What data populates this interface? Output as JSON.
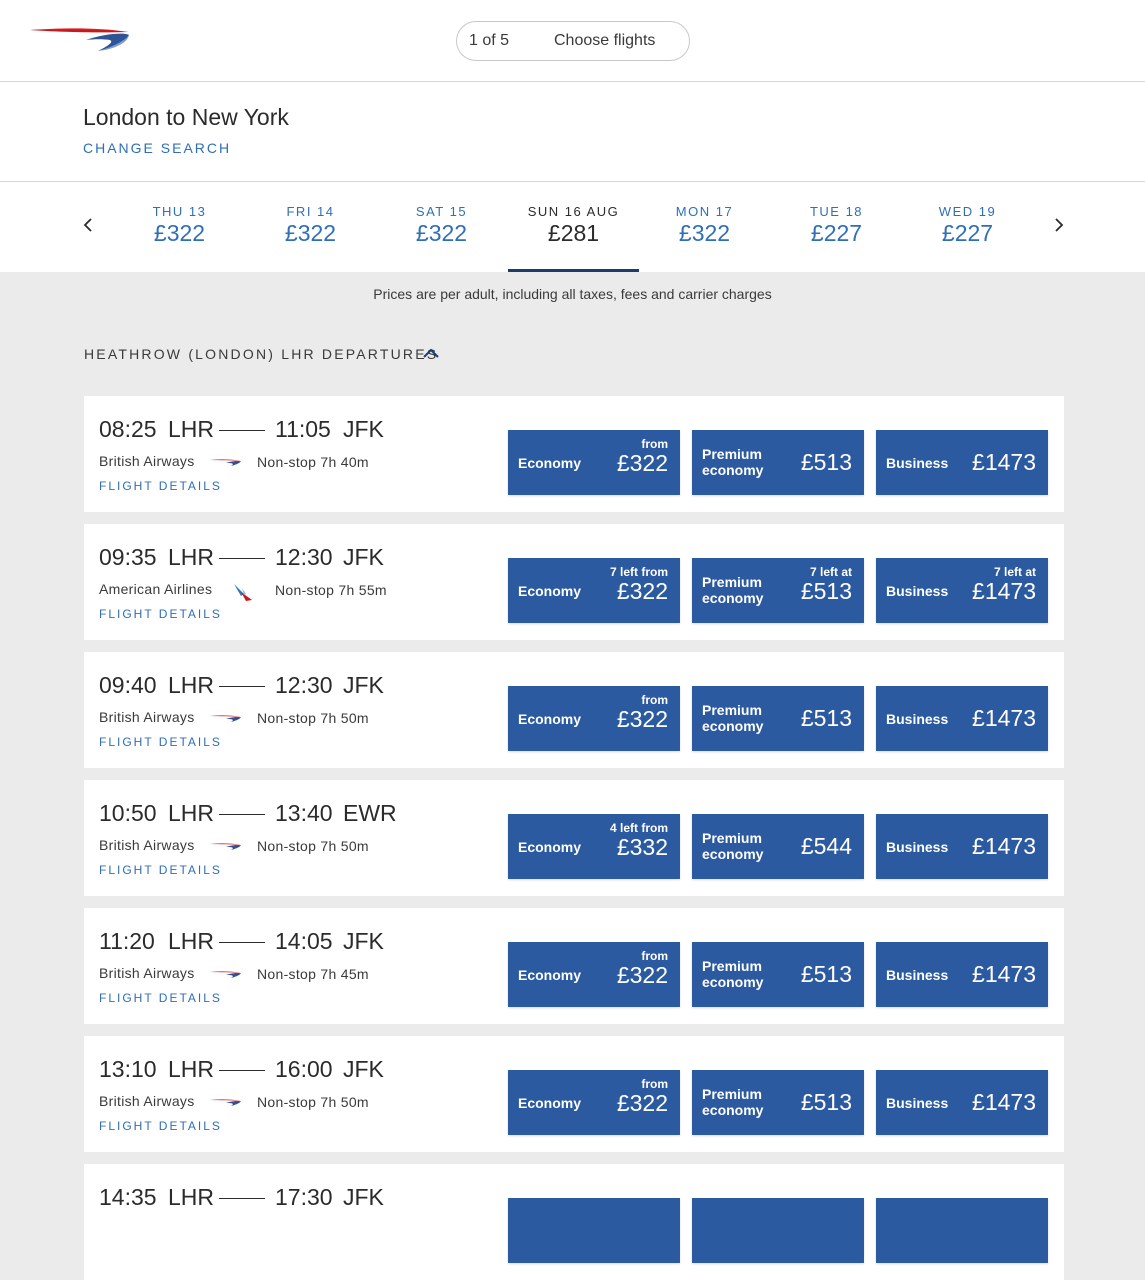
{
  "header": {
    "step_count": "1 of 5",
    "step_label": "Choose flights"
  },
  "route": {
    "title": "London to New York",
    "change_search": "CHANGE SEARCH"
  },
  "dates": [
    {
      "day": "THU 13",
      "price": "£322",
      "active": false
    },
    {
      "day": "FRI 14",
      "price": "£322",
      "active": false
    },
    {
      "day": "SAT 15",
      "price": "£322",
      "active": false
    },
    {
      "day": "SUN 16 AUG",
      "price": "£281",
      "active": true
    },
    {
      "day": "MON 17",
      "price": "£322",
      "active": false
    },
    {
      "day": "TUE 18",
      "price": "£227",
      "active": false
    },
    {
      "day": "WED 19",
      "price": "£227",
      "active": false
    }
  ],
  "price_note": "Prices are per adult, including all taxes, fees and carrier charges",
  "departures_label": "HEATHROW (LONDON) LHR DEPARTURES",
  "flights": [
    {
      "depart": "08:25",
      "from": "LHR",
      "arrive": "11:05",
      "to": "JFK",
      "airline": "British Airways",
      "airline_icon": "british-airways-logo",
      "stops": "Non-stop 7h 40m",
      "details": "FLIGHT DETAILS",
      "fares": [
        {
          "cabin": "Economy",
          "note": "from",
          "price": "£322"
        },
        {
          "cabin": "Premium economy",
          "note": "",
          "price": "£513"
        },
        {
          "cabin": "Business",
          "note": "",
          "price": "£1473"
        }
      ]
    },
    {
      "depart": "09:35",
      "from": "LHR",
      "arrive": "12:30",
      "to": "JFK",
      "airline": "American Airlines",
      "airline_icon": "american-airlines-logo",
      "stops": "Non-stop 7h 55m",
      "details": "FLIGHT DETAILS",
      "fares": [
        {
          "cabin": "Economy",
          "note": "7 left from",
          "price": "£322"
        },
        {
          "cabin": "Premium economy",
          "note": "7 left at",
          "price": "£513"
        },
        {
          "cabin": "Business",
          "note": "7 left at",
          "price": "£1473"
        }
      ]
    },
    {
      "depart": "09:40",
      "from": "LHR",
      "arrive": "12:30",
      "to": "JFK",
      "airline": "British Airways",
      "airline_icon": "british-airways-logo",
      "stops": "Non-stop 7h 50m",
      "details": "FLIGHT DETAILS",
      "fares": [
        {
          "cabin": "Economy",
          "note": "from",
          "price": "£322"
        },
        {
          "cabin": "Premium economy",
          "note": "",
          "price": "£513"
        },
        {
          "cabin": "Business",
          "note": "",
          "price": "£1473"
        }
      ]
    },
    {
      "depart": "10:50",
      "from": "LHR",
      "arrive": "13:40",
      "to": "EWR",
      "airline": "British Airways",
      "airline_icon": "british-airways-logo",
      "stops": "Non-stop 7h 50m",
      "details": "FLIGHT DETAILS",
      "fares": [
        {
          "cabin": "Economy",
          "note": "4 left from",
          "price": "£332"
        },
        {
          "cabin": "Premium economy",
          "note": "",
          "price": "£544"
        },
        {
          "cabin": "Business",
          "note": "",
          "price": "£1473"
        }
      ]
    },
    {
      "depart": "11:20",
      "from": "LHR",
      "arrive": "14:05",
      "to": "JFK",
      "airline": "British Airways",
      "airline_icon": "british-airways-logo",
      "stops": "Non-stop 7h 45m",
      "details": "FLIGHT DETAILS",
      "fares": [
        {
          "cabin": "Economy",
          "note": "from",
          "price": "£322"
        },
        {
          "cabin": "Premium economy",
          "note": "",
          "price": "£513"
        },
        {
          "cabin": "Business",
          "note": "",
          "price": "£1473"
        }
      ]
    },
    {
      "depart": "13:10",
      "from": "LHR",
      "arrive": "16:00",
      "to": "JFK",
      "airline": "British Airways",
      "airline_icon": "british-airways-logo",
      "stops": "Non-stop 7h 50m",
      "details": "FLIGHT DETAILS",
      "fares": [
        {
          "cabin": "Economy",
          "note": "from",
          "price": "£322"
        },
        {
          "cabin": "Premium economy",
          "note": "",
          "price": "£513"
        },
        {
          "cabin": "Business",
          "note": "",
          "price": "£1473"
        }
      ]
    },
    {
      "depart": "14:35",
      "from": "LHR",
      "arrive": "17:30",
      "to": "JFK",
      "airline": "",
      "airline_icon": "",
      "stops": "",
      "details": "",
      "fares": [
        {
          "cabin": "",
          "note": "",
          "price": ""
        },
        {
          "cabin": "",
          "note": "",
          "price": ""
        },
        {
          "cabin": "",
          "note": "",
          "price": ""
        }
      ]
    }
  ],
  "colors": {
    "brand_blue": "#2c5aa0",
    "link_blue": "#2e6fb7",
    "navy": "#1b3d6e",
    "speedmarque_red": "#e0262b",
    "page_bg": "#ebebeb"
  }
}
